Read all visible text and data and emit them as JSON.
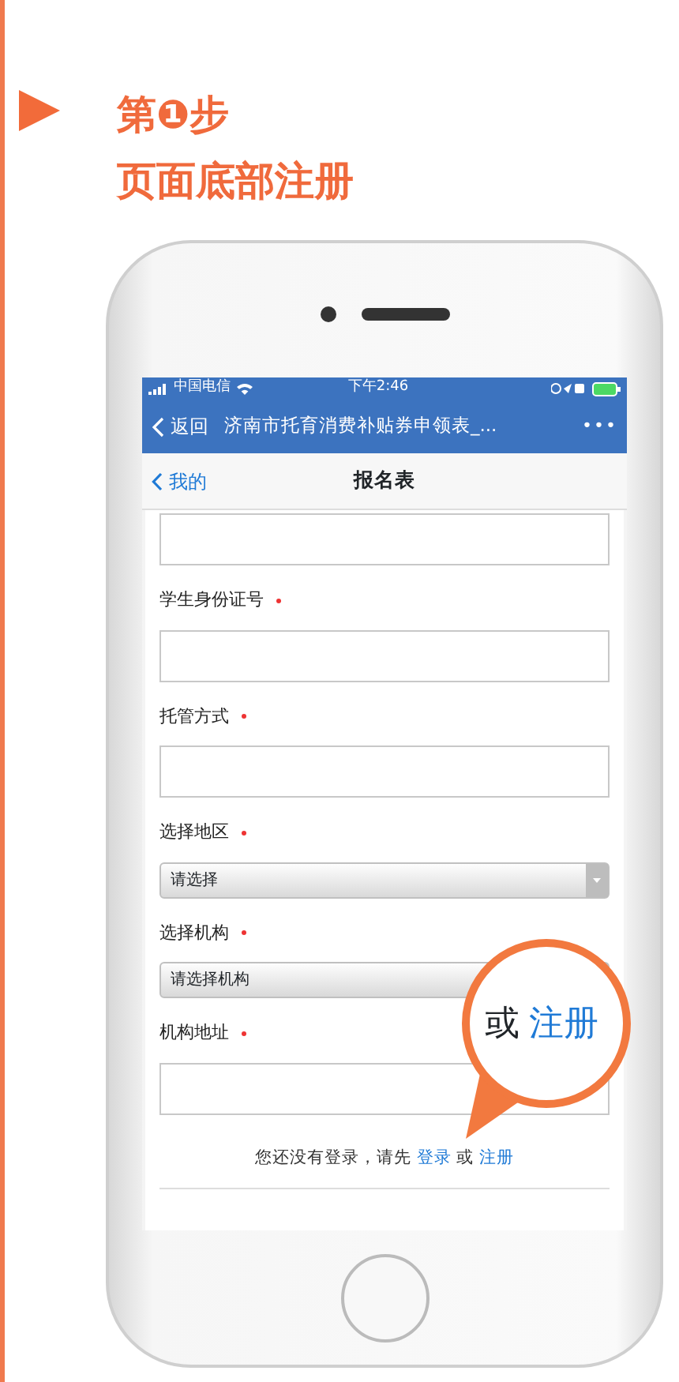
{
  "step": {
    "title": "第❶步",
    "subtitle": "页面底部注册"
  },
  "phone": {
    "status_bar": {
      "carrier": "中国电信",
      "time": "下午2:46"
    },
    "nav_bar": {
      "back": "返回",
      "title": "济南市托育消费补贴券申领表_...",
      "more": "•••"
    },
    "page_header": {
      "back": "我的",
      "title": "报名表"
    },
    "form": {
      "fields": [
        {
          "kind": "input"
        },
        {
          "kind": "input",
          "label": "学生身份证号",
          "required": true
        },
        {
          "kind": "input",
          "label": "托管方式",
          "required": true
        },
        {
          "kind": "select",
          "label": "选择地区",
          "required": true,
          "placeholder": "请选择"
        },
        {
          "kind": "select",
          "label": "选择机构",
          "required": true,
          "placeholder": "请选择机构"
        },
        {
          "kind": "input",
          "label": "机构地址",
          "required": true
        }
      ]
    },
    "login_prompt": {
      "text": "您还没有登录，请先",
      "login_link": "登录",
      "or": "或",
      "register_link": "注册"
    },
    "magnifier": {
      "text": "或",
      "link": "注册"
    }
  }
}
